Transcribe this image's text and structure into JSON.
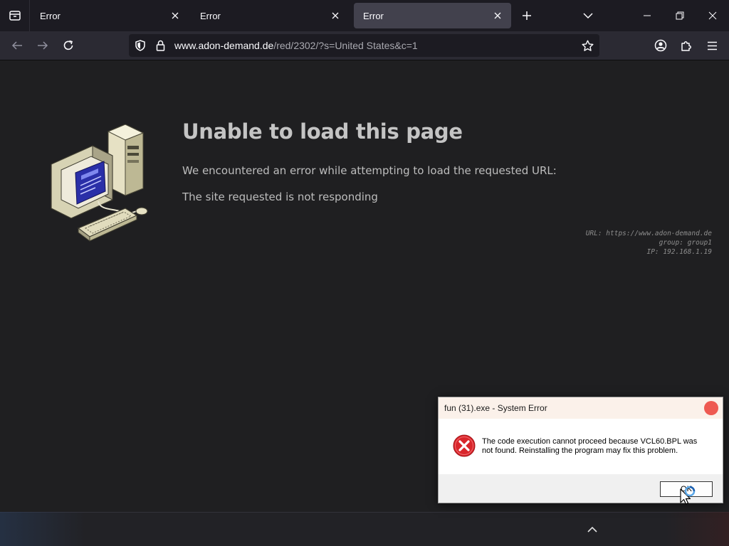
{
  "browser": {
    "tabs": [
      {
        "label": "Error",
        "active": false
      },
      {
        "label": "Error",
        "active": false
      },
      {
        "label": "Error",
        "active": true
      }
    ],
    "icons": {
      "tab_view": "firefox-view-icon",
      "tab_close": "close-icon",
      "new_tab": "plus-icon",
      "list_all_tabs": "chevron-down-icon",
      "minimize": "minimize-icon",
      "restore": "restore-icon",
      "close_window": "close-icon",
      "back": "back-arrow-icon",
      "forward": "forward-arrow-icon",
      "reload": "reload-icon",
      "shield": "shield-icon",
      "lock": "lock-icon",
      "bookmark": "star-icon",
      "account": "account-icon",
      "extensions": "puzzle-icon",
      "menu": "hamburger-menu-icon"
    },
    "url_domain": "www.adon-demand.de",
    "url_path": "/red/2302/?s=United States&c=1"
  },
  "page": {
    "title": "Unable to load this page",
    "description": "We encountered an error while attempting to load the requested URL:",
    "detail": "The site requested is not responding",
    "info_lines": [
      "URL: https://www.adon-demand.de",
      "group: group1",
      "IP: 192.168.1.19"
    ]
  },
  "dialog": {
    "title": "fun (31).exe - System Error",
    "message": "The code execution cannot proceed because VCL60.BPL was not found. Reinstalling the program may fix this problem.",
    "ok_label": "OK",
    "icon": "error-x-icon"
  },
  "colors": {
    "tab_bar": "#1c1b22",
    "toolbar": "#2b2a33",
    "active_tab": "#42414d",
    "content_bg": "#1f1f21",
    "dialog_close": "#ee5a52",
    "error_icon": "#d9262b"
  }
}
